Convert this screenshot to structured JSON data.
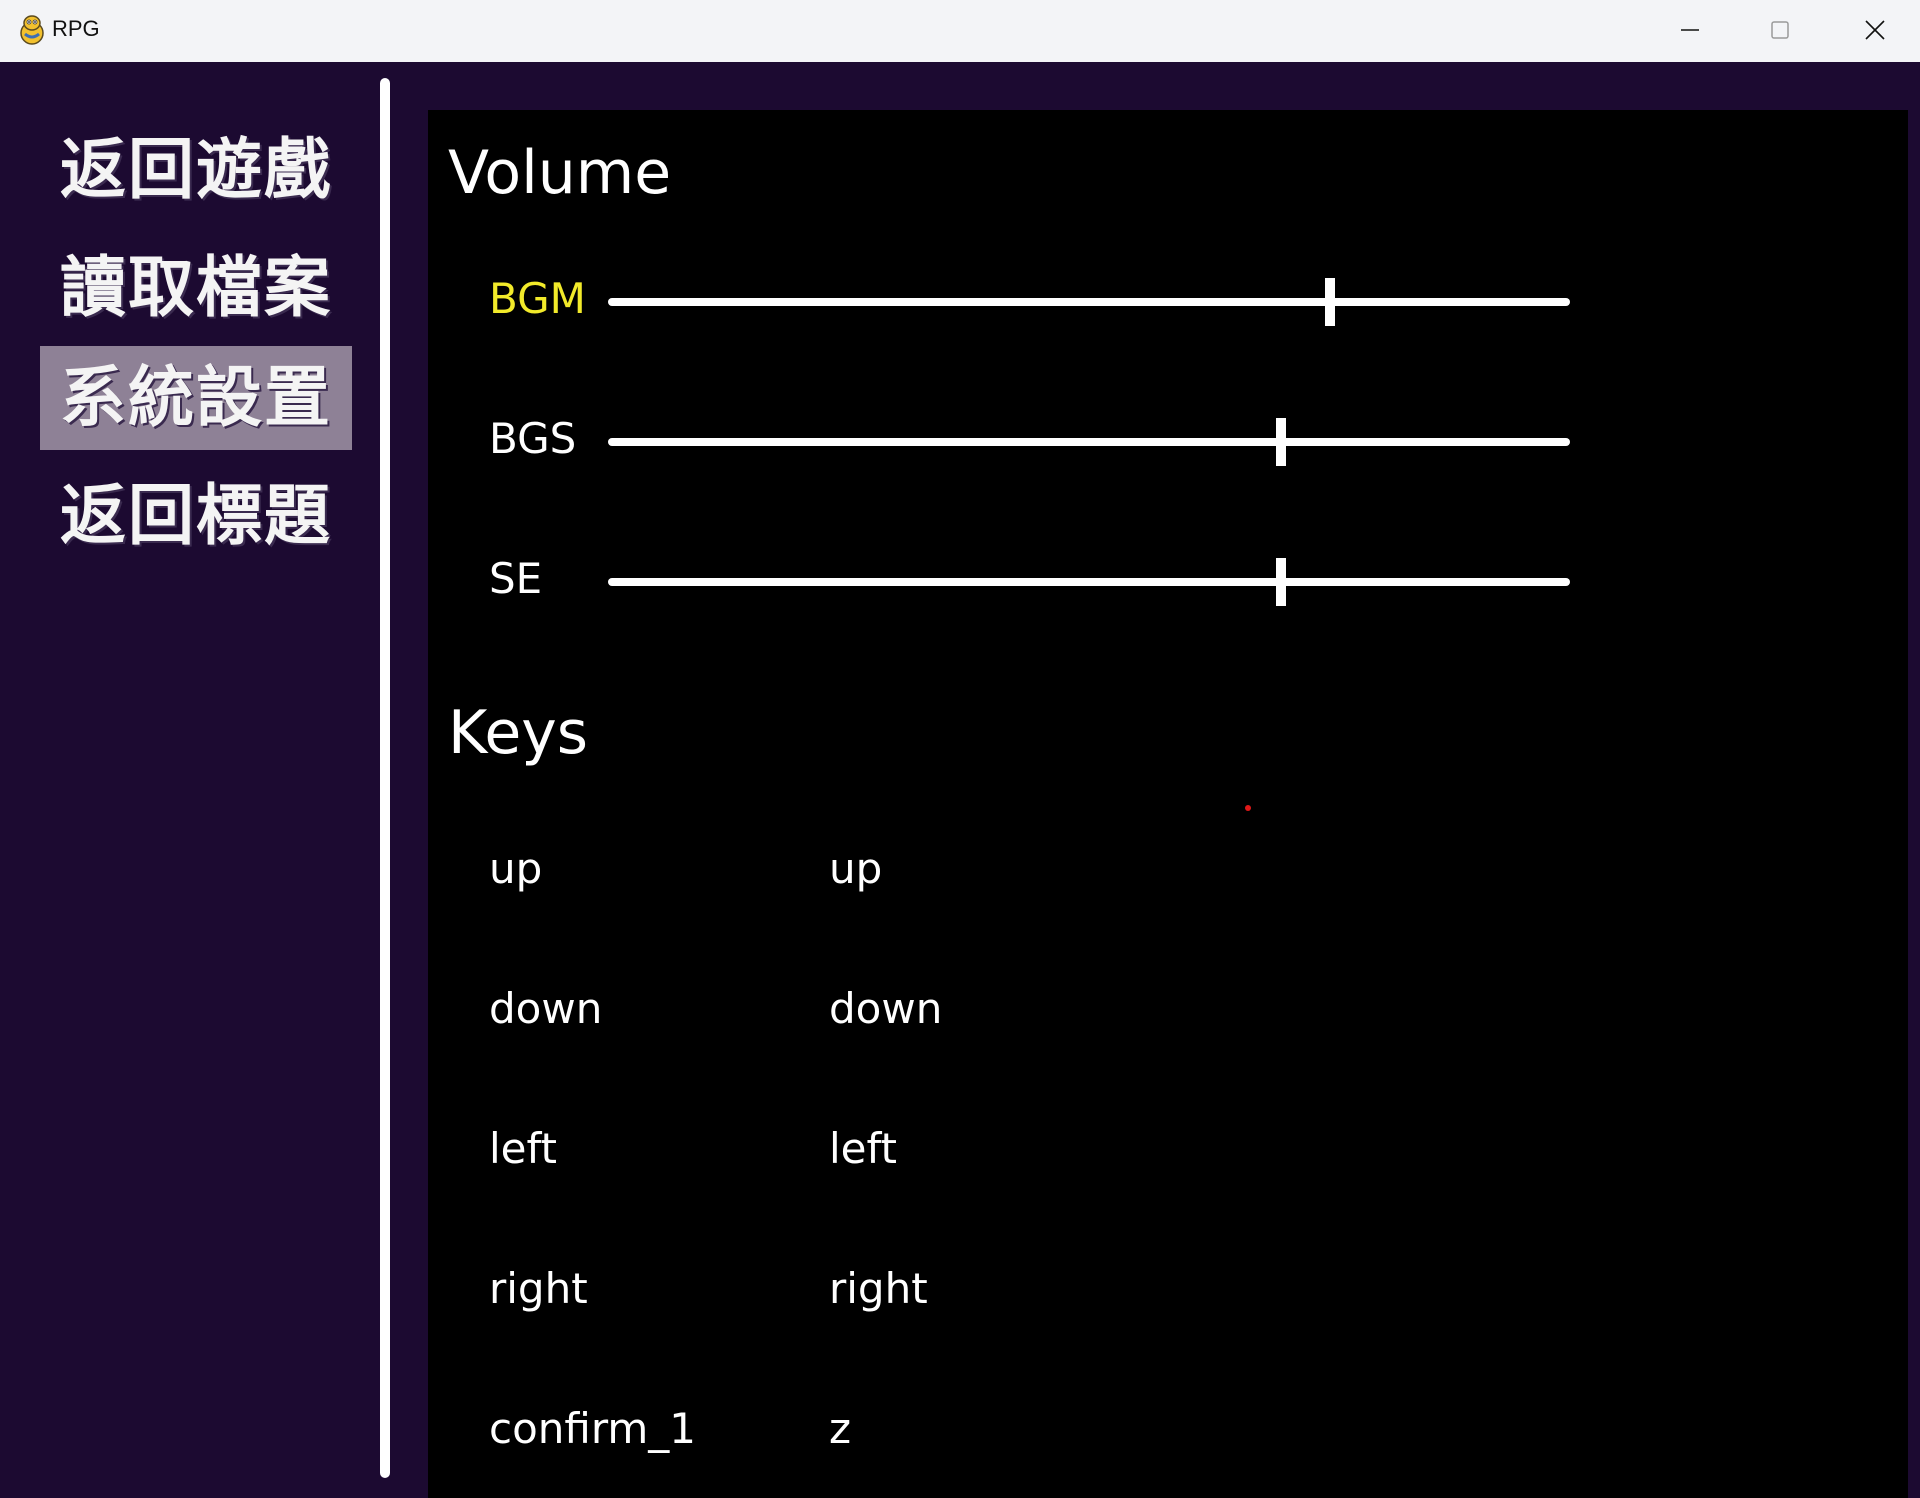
{
  "window": {
    "title": "RPG",
    "icon": "pygame-snake-icon"
  },
  "menu": {
    "items": [
      {
        "label": "返回遊戲",
        "selected": false
      },
      {
        "label": "讀取檔案",
        "selected": false
      },
      {
        "label": "系統設置",
        "selected": true
      },
      {
        "label": "返回標題",
        "selected": false
      }
    ],
    "selected_color": "#8e8196"
  },
  "settings": {
    "volume_title": "Volume",
    "sliders": [
      {
        "label": "BGM",
        "value": 0.75,
        "active": true
      },
      {
        "label": "BGS",
        "value": 0.7,
        "active": false
      },
      {
        "label": "SE",
        "value": 0.7,
        "active": false
      }
    ],
    "keys_title": "Keys",
    "keys": [
      {
        "action": "up",
        "binding": "up"
      },
      {
        "action": "down",
        "binding": "down"
      },
      {
        "action": "left",
        "binding": "left"
      },
      {
        "action": "right",
        "binding": "right"
      },
      {
        "action": "confirm_1",
        "binding": "z"
      }
    ]
  },
  "colors": {
    "background": "#1c0a31",
    "panel": "#000000",
    "active_label": "#f2ea2a",
    "text": "#ffffff"
  }
}
